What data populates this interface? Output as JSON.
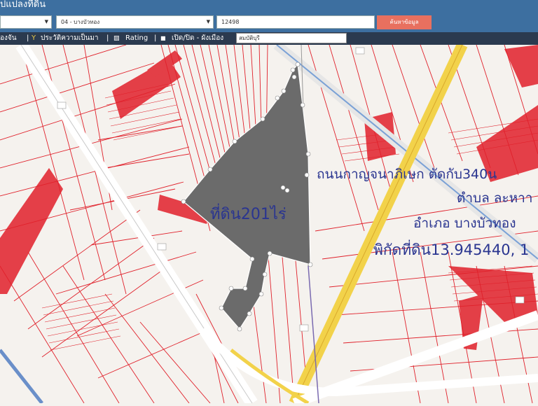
{
  "header": {
    "title": "ปแปลงที่ดิน",
    "district_select": "04 - บางบัวทอง",
    "parcel_input": "12498",
    "search_button": "ค้นหาข้อมูล"
  },
  "toolbar": {
    "item1": "องจัน",
    "item2": "ประวัติความเป็นมา",
    "item3": "Rating",
    "item4": "เปิด/ปิด - ผังเมือง",
    "search_value": "สมบัติบุรี"
  },
  "map": {
    "annotations": {
      "area": "ที่ดิน201ไร่",
      "road": "ถนนกาญจนาภิเษก ตัดกับ340น",
      "subdistrict": "ตำบล ละหาา",
      "district": "อำเภอ บางบัวทอง",
      "coords": "พิกัดที่ดิน13.945440, 1"
    },
    "colors": {
      "parcel_lines": "#e0202a",
      "highlight_parcel": "#6b6b6b",
      "annotation_text": "#2a3590",
      "major_road": "#f2d24a"
    }
  }
}
